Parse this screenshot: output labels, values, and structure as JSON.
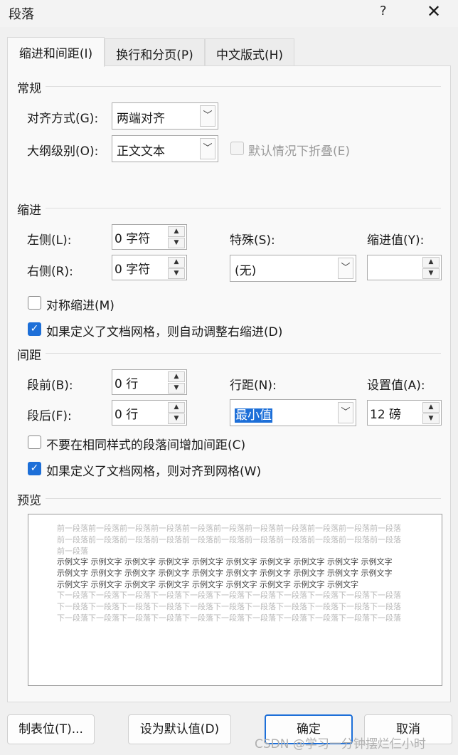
{
  "window": {
    "title": "段落",
    "help": "?",
    "close": "✕"
  },
  "tabs": [
    {
      "label": "缩进和间距(I)",
      "active": true
    },
    {
      "label": "换行和分页(P)",
      "active": false
    },
    {
      "label": "中文版式(H)",
      "active": false
    }
  ],
  "general": {
    "heading": "常规",
    "alignment_label": "对齐方式(G):",
    "alignment_value": "两端对齐",
    "outline_label": "大纲级别(O):",
    "outline_value": "正文文本",
    "collapse_label": "默认情况下折叠(E)"
  },
  "indent": {
    "heading": "缩进",
    "left_label": "左侧(L):",
    "left_value": "0 字符",
    "right_label": "右侧(R):",
    "right_value": "0 字符",
    "special_label": "特殊(S):",
    "special_value": "(无)",
    "by_label": "缩进值(Y):",
    "by_value": "",
    "mirror_label": "对称缩进(M)",
    "mirror_checked": false,
    "auto_adjust_label": "如果定义了文档网格，则自动调整右缩进(D)",
    "auto_adjust_checked": true
  },
  "spacing": {
    "heading": "间距",
    "before_label": "段前(B):",
    "before_value": "0 行",
    "after_label": "段后(F):",
    "after_value": "0 行",
    "line_label": "行距(N):",
    "line_value": "最小值",
    "at_label": "设置值(A):",
    "at_value": "12 磅",
    "no_space_label": "不要在相同样式的段落间增加间距(C)",
    "no_space_checked": false,
    "snap_grid_label": "如果定义了文档网格，则对齐到网格(W)",
    "snap_grid_checked": true
  },
  "preview": {
    "heading": "预览",
    "previous_text": "前一段落前一段落前一段落前一段落前一段落前一段落前一段落前一段落前一段落前一段落前一段落前一段落前一段落前一段落前一段落前一段落前一段落前一段落前一段落前一段落前一段落前一段落前一段落",
    "sample_text": "示例文字 示例文字 示例文字 示例文字 示例文字 示例文字 示例文字 示例文字 示例文字 示例文字 示例文字 示例文字 示例文字 示例文字 示例文字 示例文字 示例文字 示例文字 示例文字 示例文字 示例文字 示例文字 示例文字 示例文字 示例文字 示例文字 示例文字 示例文字 示例文字",
    "next_text": "下一段落下一段落下一段落下一段落下一段落下一段落下一段落下一段落下一段落下一段落下一段落下一段落下一段落下一段落下一段落下一段落下一段落下一段落下一段落下一段落下一段落下一段落下一段落下一段落下一段落下一段落下一段落下一段落下一段落下一段落下一段落下一段落下一段落"
  },
  "buttons": {
    "tabs": "制表位(T)...",
    "set_default": "设为默认值(D)",
    "ok": "确定",
    "cancel": "取消"
  },
  "watermark": "CSDN @学习一分钟摆烂仨小时",
  "colors": {
    "accent": "#1d6fd8",
    "background": "#f0f0f0",
    "panel": "#f9f9f9"
  }
}
